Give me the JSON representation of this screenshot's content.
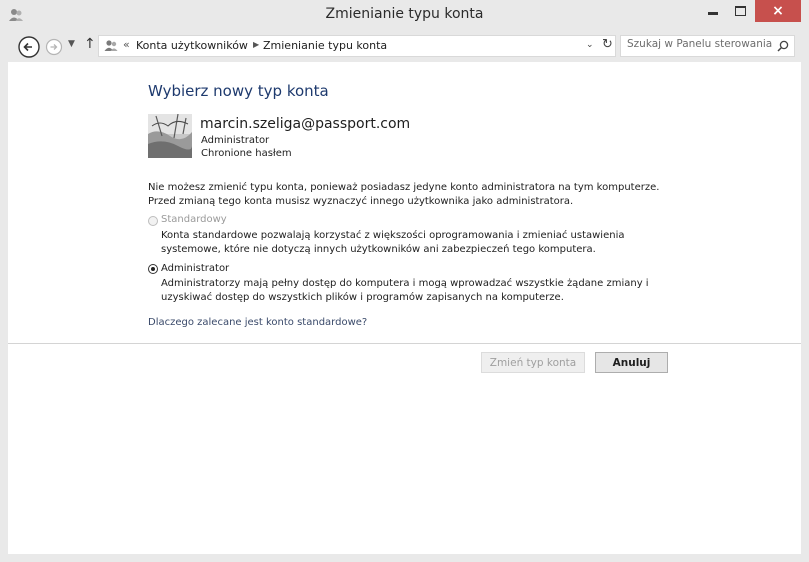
{
  "window": {
    "title": "Zmienianie typu konta",
    "close_glyph": "×"
  },
  "addressbar": {
    "overflow": "«",
    "breadcrumbs": [
      "Konta użytkowników",
      "Zmienianie typu konta"
    ],
    "search_placeholder": "Szukaj w Panelu sterowania"
  },
  "main": {
    "heading": "Wybierz nowy typ konta",
    "account": {
      "email": "marcin.szeliga@passport.com",
      "type": "Administrator",
      "protection": "Chronione hasłem"
    },
    "info": "Nie możesz zmienić typu konta, ponieważ posiadasz jedyne konto administratora na tym komputerze. Przed zmianą tego konta musisz wyznaczyć innego użytkownika jako administratora.",
    "options": [
      {
        "label": "Standardowy",
        "description": "Konta standardowe pozwalają korzystać z większości oprogramowania i zmieniać ustawienia systemowe, które nie dotyczą innych użytkowników ani zabezpieczeń tego komputera.",
        "selected": false,
        "disabled": true
      },
      {
        "label": "Administrator",
        "description": "Administratorzy mają pełny dostęp do komputera i mogą wprowadzać wszystkie żądane zmiany i uzyskiwać dostęp do wszystkich plików i programów zapisanych na komputerze.",
        "selected": true,
        "disabled": false
      }
    ],
    "why_link": "Dlaczego zalecane jest konto standardowe?"
  },
  "buttons": {
    "change": "Zmień typ konta",
    "cancel": "Anuluj"
  },
  "colors": {
    "chrome": "#e9e9e9",
    "close_button": "#c7504d",
    "heading": "#1e3a6e"
  },
  "icons": [
    "user-accounts-icon",
    "back-icon",
    "forward-icon",
    "recent-pages-icon",
    "up-icon",
    "refresh-icon",
    "search-icon"
  ]
}
